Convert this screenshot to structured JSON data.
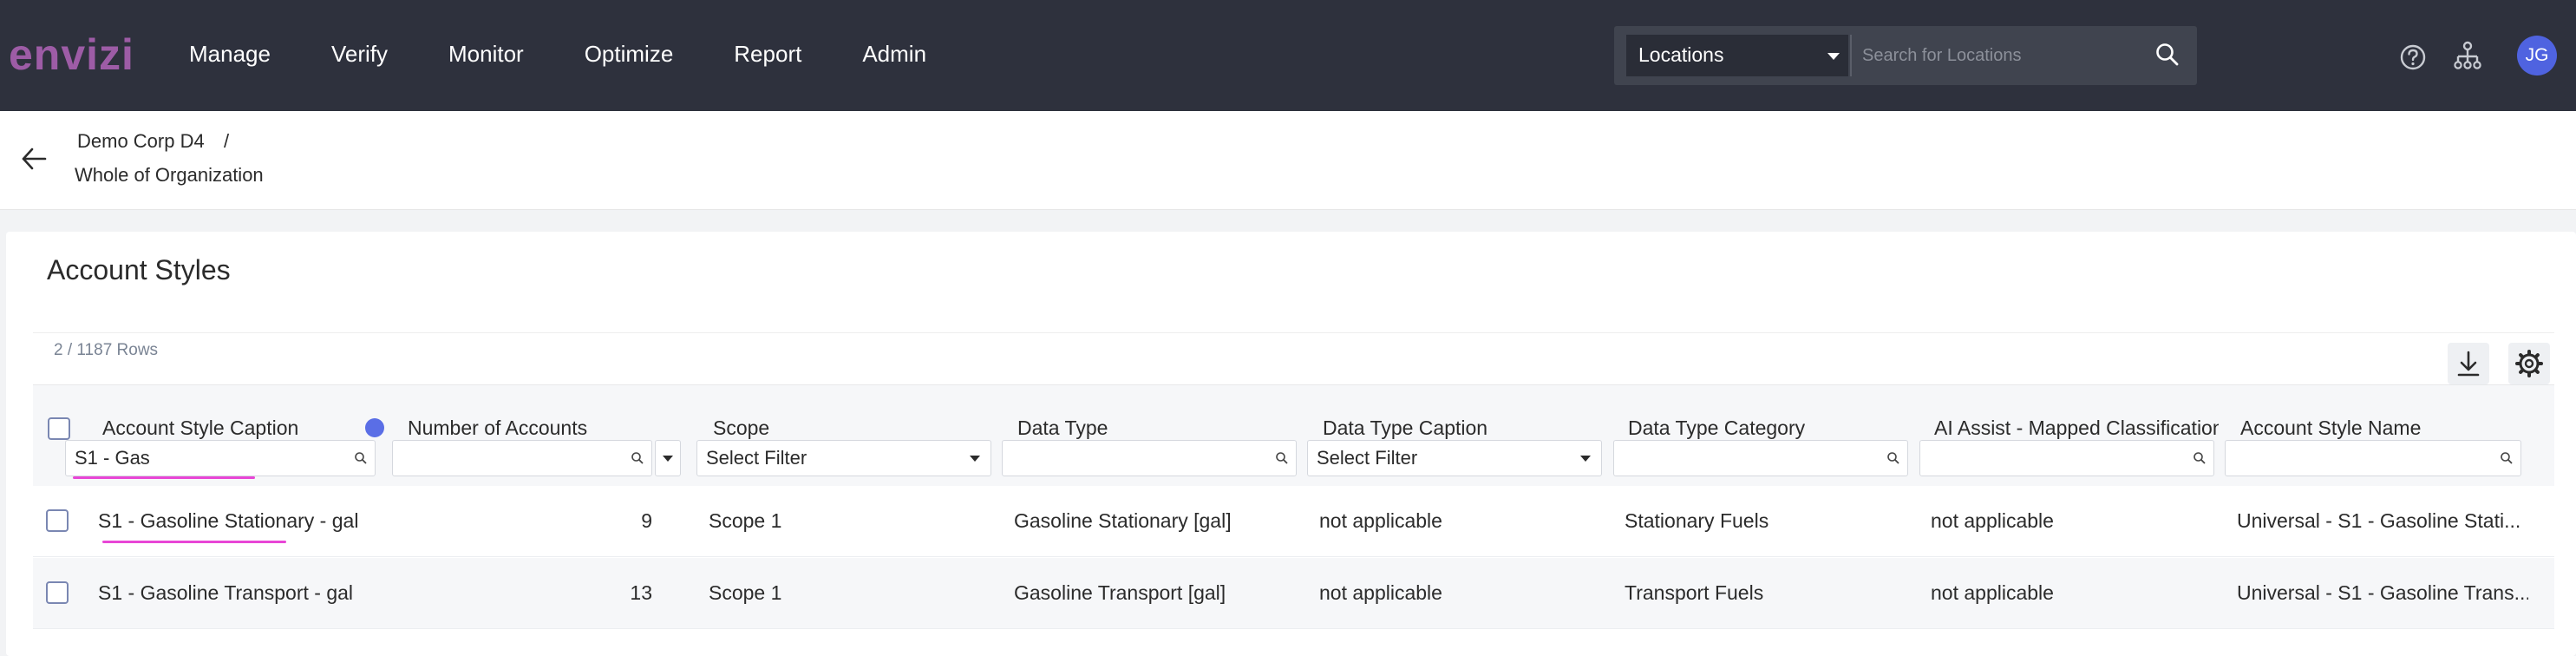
{
  "app": {
    "logo_text": "envizi",
    "brand_color": "#9d5ca6",
    "nav": [
      "Manage",
      "Verify",
      "Monitor",
      "Optimize",
      "Report",
      "Admin"
    ]
  },
  "header": {
    "location_select": "Locations",
    "search_placeholder": "Search for Locations",
    "user_initials": "JG",
    "avatar_color": "#4f63e0"
  },
  "breadcrumb": {
    "parent": "Demo Corp D4",
    "separator": "/",
    "current": "Whole of Organization"
  },
  "page": {
    "title": "Account Styles",
    "row_count": "2 / 1187 Rows"
  },
  "grid": {
    "columns": [
      "Account Style Caption",
      "Number of Accounts",
      "Scope",
      "Data Type",
      "Data Type Caption",
      "Data Type Category",
      "AI Assist - Mapped Classification",
      "Account Style Name"
    ],
    "filters": {
      "caption": "S1 - Gas",
      "scope": "Select Filter",
      "data_type_caption": "Select Filter"
    },
    "rows": [
      {
        "caption": "S1 - Gasoline Stationary - gal",
        "count": "9",
        "scope": "Scope 1",
        "data_type": "Gasoline Stationary [gal]",
        "data_type_caption": "not applicable",
        "category": "Stationary Fuels",
        "ai_class": "not applicable",
        "style_name": "Universal - S1 - Gasoline Stati..."
      },
      {
        "caption": "S1 - Gasoline Transport - gal",
        "count": "13",
        "scope": "Scope 1",
        "data_type": "Gasoline Transport [gal]",
        "data_type_caption": "not applicable",
        "category": "Transport Fuels",
        "ai_class": "not applicable",
        "style_name": "Universal - S1 - Gasoline Trans..."
      }
    ]
  }
}
